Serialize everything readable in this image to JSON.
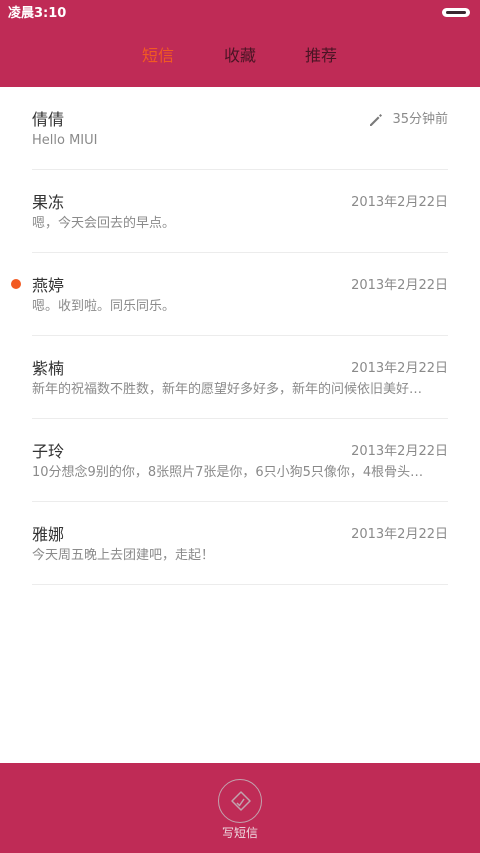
{
  "status_bar": {
    "time": "凌晨3:10"
  },
  "tabs": [
    {
      "label": "短信",
      "active": true
    },
    {
      "label": "收藏",
      "active": false
    },
    {
      "label": "推荐",
      "active": false
    }
  ],
  "conversations": [
    {
      "name": "倩倩",
      "preview": "Hello MIUI",
      "date": "35分钟前",
      "icon": "pencil-icon",
      "unread": false
    },
    {
      "name": "果冻",
      "preview": "嗯，今天会回去的早点。",
      "date": "2013年2月22日",
      "unread": false
    },
    {
      "name": "燕婷",
      "preview": "嗯。收到啦。同乐同乐。",
      "date": "2013年2月22日",
      "unread": true
    },
    {
      "name": "紫楠",
      "preview": "新年的祝福数不胜数，新年的愿望好多好多，新年的问候依旧美好…",
      "date": "2013年2月22日",
      "unread": false
    },
    {
      "name": "子玲",
      "preview": "10分想念9别的你，8张照片7张是你，6只小狗5只像你，4根骨头…",
      "date": "2013年2月22日",
      "unread": false
    },
    {
      "name": "雅娜",
      "preview": "今天周五晚上去团建吧，走起！",
      "date": "2013年2月22日",
      "unread": false
    }
  ],
  "bottom_bar": {
    "compose_label": "写短信"
  },
  "colors": {
    "brand": "#bf2b56",
    "accent": "#f25a22"
  }
}
